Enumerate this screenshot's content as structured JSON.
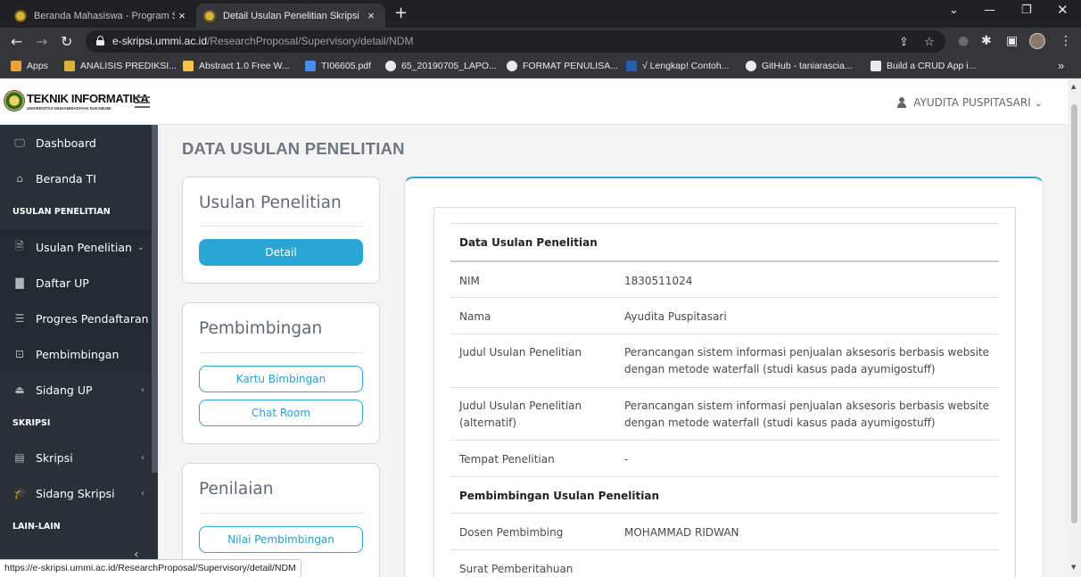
{
  "browser": {
    "tabs": [
      {
        "title": "Beranda Mahasiswa - Program St",
        "close": "×"
      },
      {
        "title": "Detail Usulan Penelitian Skripsi",
        "close": "×"
      }
    ],
    "new_tab": "+",
    "url_host": "e-skripsi.ummi.ac.id",
    "url_path": "/ResearchProposal/Supervisory/detail/NDM",
    "bookmarks": [
      {
        "label": "Apps",
        "icon": "apps-grid-icon",
        "color": "#e8a33a"
      },
      {
        "label": "ANALISIS PREDIKSI...",
        "icon": "image-icon",
        "color": "#d9b23a"
      },
      {
        "label": "Abstract 1.0 Free W...",
        "icon": "slides-icon",
        "color": "#f4c542"
      },
      {
        "label": "TI06605.pdf",
        "icon": "doc-icon",
        "color": "#4a8af4"
      },
      {
        "label": "65_20190705_LAPO...",
        "icon": "globe-icon",
        "color": "#e8eaed"
      },
      {
        "label": "FORMAT PENULISA...",
        "icon": "globe-icon",
        "color": "#e8eaed"
      },
      {
        "label": "√ Lengkap! Contoh...",
        "icon": "tm-icon",
        "color": "#2a5db0"
      },
      {
        "label": "GitHub - taniarascia...",
        "icon": "github-icon",
        "color": "#e8eaed"
      },
      {
        "label": "Build a CRUD App i...",
        "icon": "file-icon",
        "color": "#e8eaed"
      }
    ],
    "bookmarks_more": "»",
    "status_url": "https://e-skripsi.ummi.ac.id/ResearchProposal/Supervisory/detail/NDM"
  },
  "header": {
    "logo_title": "TEKNIK INFORMATIKA",
    "logo_subtitle": "UNIVERSITAS MUHAMMADIYAH SUKABUMI",
    "user_name": "AYUDITA PUSPITASARI"
  },
  "sidebar": {
    "items": [
      {
        "label": "Dashboard",
        "icon": "monitor-icon",
        "glyph": "🖵"
      },
      {
        "label": "Beranda TI",
        "icon": "home-icon",
        "glyph": "⌂"
      },
      {
        "label": "Usulan Penelitian",
        "icon": "file-text-icon",
        "glyph": "🗎",
        "chevron": "⌄"
      },
      {
        "label": "Daftar UP",
        "icon": "file-icon",
        "glyph": "▇"
      },
      {
        "label": "Progres Pendaftaran",
        "icon": "list-icon",
        "glyph": "☰"
      },
      {
        "label": "Pembimbingan",
        "icon": "chalkboard-icon",
        "glyph": "⊡"
      },
      {
        "label": "Sidang UP",
        "icon": "institution-icon",
        "glyph": "⏏",
        "chevron": "‹"
      },
      {
        "label": "Skripsi",
        "icon": "book-icon",
        "glyph": "▤",
        "chevron": "‹"
      },
      {
        "label": "Sidang Skripsi",
        "icon": "graduation-cap-icon",
        "glyph": "🎓",
        "chevron": "‹"
      }
    ],
    "headers": [
      "USULAN PENELITIAN",
      "SKRIPSI",
      "LAIN-LAIN"
    ],
    "collapse": "‹"
  },
  "main": {
    "page_title": "DATA USULAN PENELITIAN",
    "cards": [
      {
        "title": "Usulan Penelitian",
        "buttons": [
          "Detail"
        ]
      },
      {
        "title": "Pembimbingan",
        "buttons": [
          "Kartu Bimbingan",
          "Chat Room"
        ]
      },
      {
        "title": "Penilaian",
        "buttons": [
          "Nilai Pembimbingan"
        ]
      }
    ],
    "detail": {
      "section1": "Data Usulan Penelitian",
      "rows": [
        {
          "label": "NIM",
          "value": "1830511024"
        },
        {
          "label": "Nama",
          "value": "Ayudita Puspitasari"
        },
        {
          "label": "Judul Usulan Penelitian",
          "value": "Perancangan sistem informasi penjualan aksesoris berbasis website dengan metode waterfall (studi kasus pada ayumigostuff)"
        },
        {
          "label": "Judul Usulan Penelitian (alternatif)",
          "value": "Perancangan sistem informasi penjualan aksesoris berbasis website dengan metode waterfall (studi kasus pada ayumigostuff)"
        },
        {
          "label": "Tempat Penelitian",
          "value": "-"
        }
      ],
      "section2": "Pembimbingan Usulan Penelitian",
      "rows2": [
        {
          "label": "Dosen Pembimbing",
          "value": "MOHAMMAD RIDWAN"
        },
        {
          "label": "Surat Pemberitahuan",
          "value": ""
        }
      ]
    }
  },
  "colors": {
    "accent": "#2aa6d4",
    "sidebar_bg": "#2a3038",
    "browser_dark": "#202124"
  }
}
